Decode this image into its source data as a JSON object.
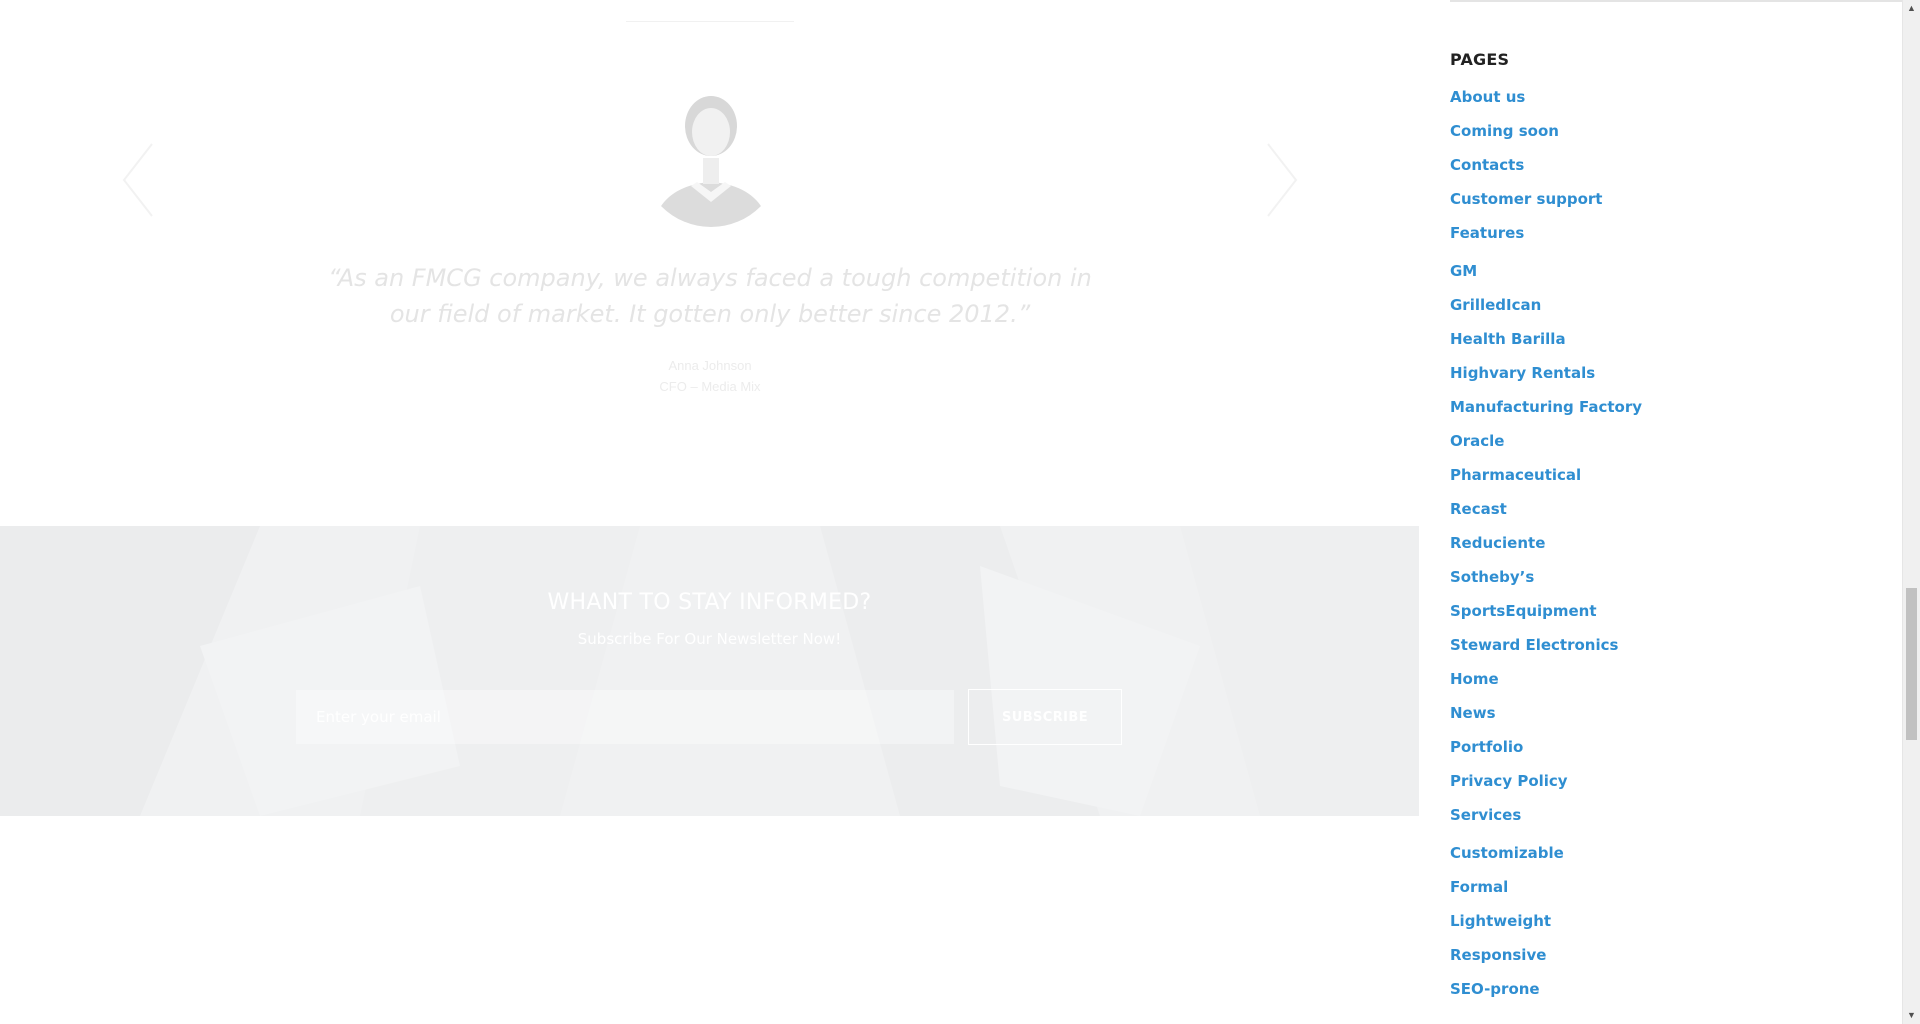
{
  "testimonial": {
    "quote": "“As an FMCG company, we always faced a tough competition in our field of market. It gotten only better since 2012.”",
    "author_name": "Anna Johnson",
    "author_role": "CFO – Media Mix"
  },
  "newsletter": {
    "title": "WHANT TO STAY INFORMED?",
    "subtitle": "Subscribe For Our Newsletter Now!",
    "email_placeholder": "Enter your email",
    "subscribe_label": "SUBSCRIBE"
  },
  "sidebar": {
    "heading": "PAGES",
    "links": [
      "About us",
      "Coming soon",
      "Contacts",
      "Customer support",
      "Features",
      "GM",
      "GrilledIcan",
      "Health Barilla",
      "Highvary Rentals",
      "Manufacturing Factory",
      "Oracle",
      "Pharmaceutical",
      "Recast",
      "Reduciente",
      "Sotheby’s",
      "SportsEquipment",
      "Steward Electronics",
      "Home",
      "News",
      "Portfolio",
      "Privacy Policy",
      "Services",
      "Customizable",
      "Formal",
      "Lightweight",
      "Responsive",
      "SEO-prone"
    ]
  },
  "colors": {
    "link": "#2f8ed1",
    "heading": "#222222",
    "newsletter_bg": "#f0f1f2"
  }
}
